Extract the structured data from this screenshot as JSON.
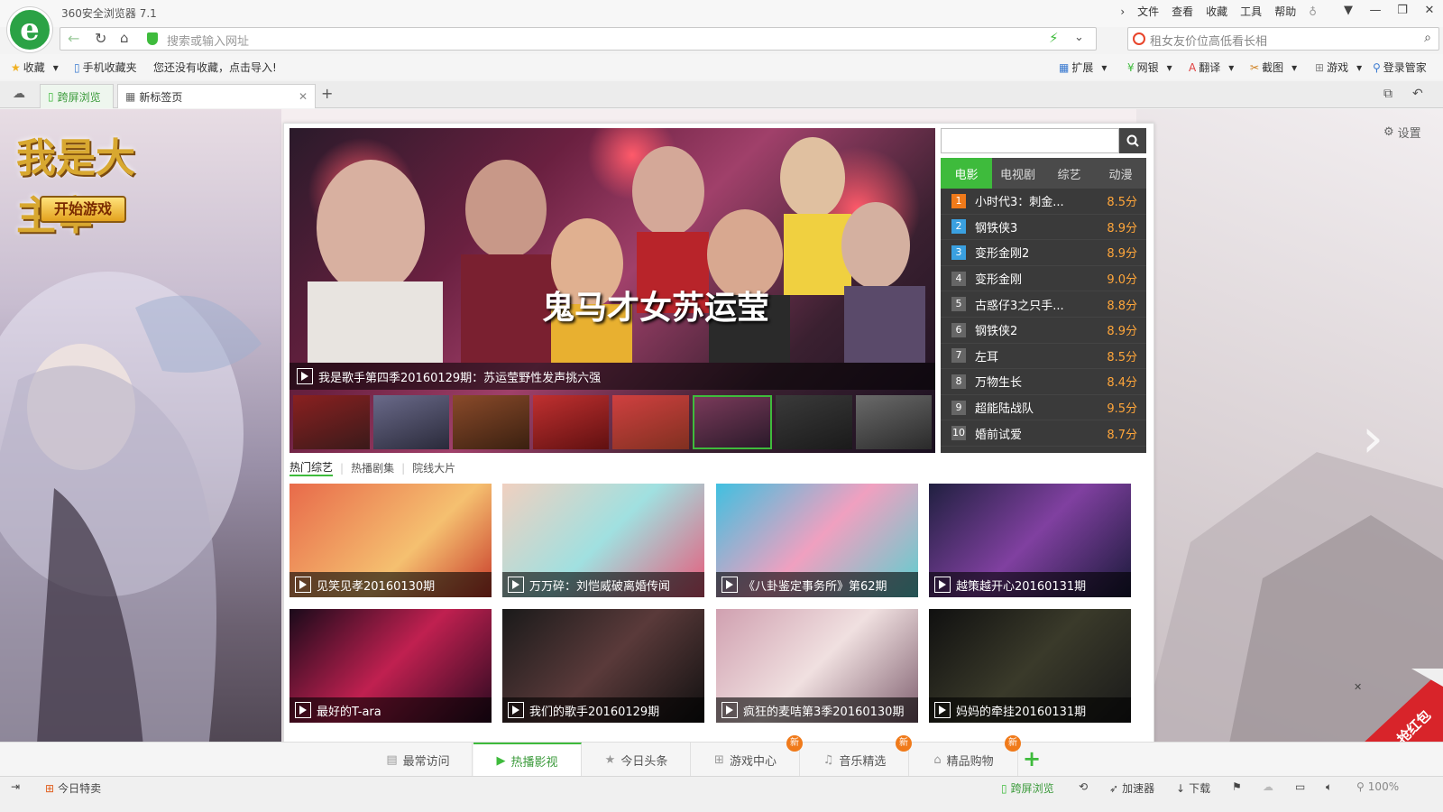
{
  "window": {
    "title": "360安全浏览器 7.1",
    "menus": [
      "文件",
      "查看",
      "收藏",
      "工具",
      "帮助"
    ]
  },
  "nav": {
    "url_placeholder": "搜索或输入网址",
    "search_placeholder": "租女友价位高低看长相"
  },
  "bookmarks": {
    "favorites": "收藏",
    "mobile": "手机收藏夹",
    "hint": "您还没有收藏，点击导入!",
    "right": [
      "扩展",
      "网银",
      "翻译",
      "截图",
      "游戏",
      "登录管家"
    ]
  },
  "tabs": {
    "cross_screen": "跨屏浏览",
    "new_tab": "新标签页"
  },
  "page": {
    "settings": "设置",
    "game_title": "我是大主宰",
    "start_game": "开始游戏",
    "hero_caption": "我是歌手第四季20160129期：苏运莹野性发声挑六强",
    "hero_overlay": "鬼马才女苏运莹",
    "categories": [
      "电影",
      "电视剧",
      "综艺",
      "动漫"
    ],
    "ranking": [
      {
        "n": "1",
        "title": "小时代3：刺金...",
        "score": "8.5分"
      },
      {
        "n": "2",
        "title": "钢铁侠3",
        "score": "8.9分"
      },
      {
        "n": "3",
        "title": "变形金刚2",
        "score": "8.9分"
      },
      {
        "n": "4",
        "title": "变形金刚",
        "score": "9.0分"
      },
      {
        "n": "5",
        "title": "古惑仔3之只手...",
        "score": "8.8分"
      },
      {
        "n": "6",
        "title": "钢铁侠2",
        "score": "8.9分"
      },
      {
        "n": "7",
        "title": "左耳",
        "score": "8.5分"
      },
      {
        "n": "8",
        "title": "万物生长",
        "score": "8.4分"
      },
      {
        "n": "9",
        "title": "超能陆战队",
        "score": "9.5分"
      },
      {
        "n": "10",
        "title": "婚前试爱",
        "score": "8.7分"
      }
    ],
    "subtabs": [
      "热门综艺",
      "热播剧集",
      "院线大片"
    ],
    "cards": [
      {
        "title": "见笑见孝20160130期"
      },
      {
        "title": "万万碎：刘恺威破离婚传闻"
      },
      {
        "title": "《八卦鉴定事务所》第62期"
      },
      {
        "title": "越策越开心20160131期"
      },
      {
        "title": "最好的T-ara"
      },
      {
        "title": "我们的歌手20160129期"
      },
      {
        "title": "疯狂的麦咭第3季20160130期"
      },
      {
        "title": "妈妈的牵挂20160131期"
      }
    ],
    "hongbao": "抢红包"
  },
  "bottom_nav": [
    {
      "label": "最常访问",
      "new": ""
    },
    {
      "label": "热播影视",
      "new": ""
    },
    {
      "label": "今日头条",
      "new": ""
    },
    {
      "label": "游戏中心",
      "new": "新"
    },
    {
      "label": "音乐精选",
      "new": "新"
    },
    {
      "label": "精品购物",
      "new": "新"
    }
  ],
  "status": {
    "today_deal": "今日特卖",
    "cross_screen": "跨屏浏览",
    "accelerator": "加速器",
    "download": "下载",
    "zoom": "100%"
  },
  "colors": {
    "brand_green": "#3ebb3c",
    "score_orange": "#ffa63a",
    "rank_bg": "#3a3a3a"
  }
}
